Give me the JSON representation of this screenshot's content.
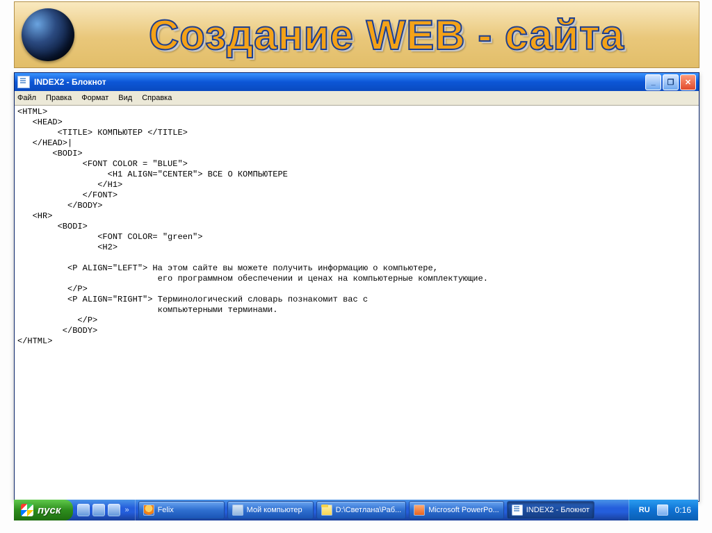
{
  "banner": {
    "title": "Создание WEB - сайта"
  },
  "window": {
    "title": "INDEX2 - Блокнот",
    "min": "_",
    "max": "❐",
    "close": "✕"
  },
  "menu": {
    "file": "Файл",
    "edit": "Правка",
    "format": "Формат",
    "view": "Вид",
    "help": "Справка"
  },
  "code": "<HTML>\n   <HEAD>\n        <TITLE> КОМПЬЮТЕР </TITLE>\n   </HEAD>|\n       <BODI>\n             <FONT COLOR = \"BLUE\">\n                  <H1 ALIGN=\"CENTER\"> ВСЕ О КОМПЬЮТЕРЕ\n                </H1>\n             </FONT>\n          </BODY>\n   <HR>\n        <BODI>\n                <FONT COLOR= \"green\">\n                <H2>\n\n          <P ALIGN=\"LEFT\"> На этом сайте вы можете получить информацию о компьютере,\n                            его программном обеспечении и ценах на компьютерные комплектующие.\n          </P>\n          <P ALIGN=\"RIGHT\"> Терминологический словарь познакомит вас с\n                            компьютерными терминами.\n            </P>\n         </BODY>\n</HTML>",
  "taskbar": {
    "start": "пуск",
    "tasks": [
      {
        "icon": "fx",
        "label": "Felix"
      },
      {
        "icon": "pc",
        "label": "Мой компьютер"
      },
      {
        "icon": "fold",
        "label": "D:\\Светлана\\Раб..."
      },
      {
        "icon": "pp",
        "label": "Microsoft PowerPo..."
      },
      {
        "icon": "np",
        "label": "INDEX2 - Блокнот",
        "active": true
      }
    ],
    "lang": "RU",
    "clock": "0:16"
  }
}
